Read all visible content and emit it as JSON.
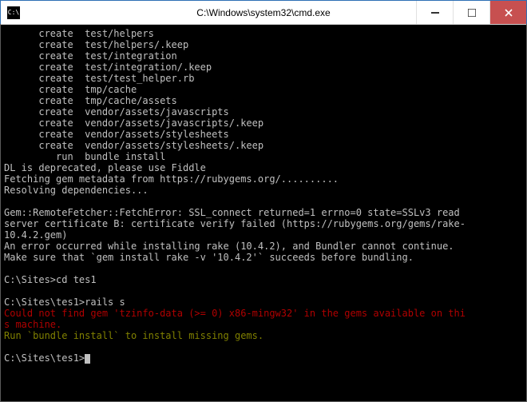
{
  "window": {
    "title": "C:\\Windows\\system32\\cmd.exe",
    "icon_text": "C:\\"
  },
  "lines": [
    {
      "cls": "",
      "text": "      create  test/helpers"
    },
    {
      "cls": "",
      "text": "      create  test/helpers/.keep"
    },
    {
      "cls": "",
      "text": "      create  test/integration"
    },
    {
      "cls": "",
      "text": "      create  test/integration/.keep"
    },
    {
      "cls": "",
      "text": "      create  test/test_helper.rb"
    },
    {
      "cls": "",
      "text": "      create  tmp/cache"
    },
    {
      "cls": "",
      "text": "      create  tmp/cache/assets"
    },
    {
      "cls": "",
      "text": "      create  vendor/assets/javascripts"
    },
    {
      "cls": "",
      "text": "      create  vendor/assets/javascripts/.keep"
    },
    {
      "cls": "",
      "text": "      create  vendor/assets/stylesheets"
    },
    {
      "cls": "",
      "text": "      create  vendor/assets/stylesheets/.keep"
    },
    {
      "cls": "",
      "text": "         run  bundle install"
    },
    {
      "cls": "",
      "text": "DL is deprecated, please use Fiddle"
    },
    {
      "cls": "",
      "text": "Fetching gem metadata from https://rubygems.org/.........."
    },
    {
      "cls": "",
      "text": "Resolving dependencies..."
    },
    {
      "cls": "",
      "text": ""
    },
    {
      "cls": "",
      "text": "Gem::RemoteFetcher::FetchError: SSL_connect returned=1 errno=0 state=SSLv3 read"
    },
    {
      "cls": "",
      "text": "server certificate B: certificate verify failed (https://rubygems.org/gems/rake-"
    },
    {
      "cls": "",
      "text": "10.4.2.gem)"
    },
    {
      "cls": "",
      "text": "An error occurred while installing rake (10.4.2), and Bundler cannot continue."
    },
    {
      "cls": "",
      "text": "Make sure that `gem install rake -v '10.4.2'` succeeds before bundling."
    },
    {
      "cls": "",
      "text": ""
    },
    {
      "cls": "",
      "text": "C:\\Sites>cd tes1"
    },
    {
      "cls": "",
      "text": ""
    },
    {
      "cls": "",
      "text": "C:\\Sites\\tes1>rails s"
    },
    {
      "cls": "red",
      "text": "Could not find gem 'tzinfo-data (>= 0) x86-mingw32' in the gems available on thi"
    },
    {
      "cls": "red",
      "text": "s machine."
    },
    {
      "cls": "olive",
      "text": "Run `bundle install` to install missing gems."
    },
    {
      "cls": "",
      "text": ""
    }
  ],
  "prompt": "C:\\Sites\\tes1>"
}
